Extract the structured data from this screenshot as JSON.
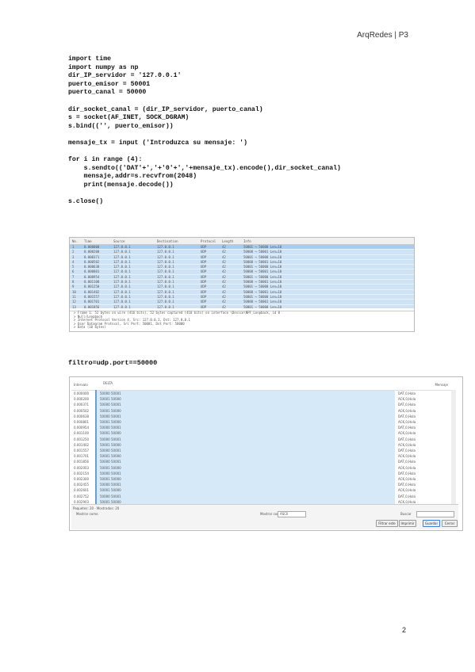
{
  "header": {
    "text": "ArqRedes | P3"
  },
  "code": {
    "lines": [
      "import time",
      "import numpy as np",
      "dir_IP_servidor = '127.0.0.1'",
      "puerto_emisor = 50001",
      "puerto_canal = 50000",
      "",
      "dir_socket_canal = (dir_IP_servidor, puerto_canal)",
      "s = socket(AF_INET, SOCK_DGRAM)",
      "s.bind(('', puerto_emisor))",
      "",
      "mensaje_tx = input ('Introduzca su mensaje: ')",
      "",
      "for i in range (4):",
      "    s.sendto(('DAT'+','+'0'+','+mensaje_tx).encode(),dir_socket_canal)",
      "    mensaje,addr=s.recvfrom(2048)",
      "    print(mensaje.decode())",
      "",
      "s.close()"
    ]
  },
  "capture1": {
    "columns": [
      "No.",
      "Time",
      "Source",
      "Destination",
      "Protocol",
      "Length",
      "Info"
    ],
    "rows": [
      {
        "time": "0.000000",
        "src": "127.0.0.1",
        "dst": "127.0.0.1",
        "proto": "UDP",
        "info": "50001 → 50000 Len=10"
      },
      {
        "time": "0.000200",
        "src": "127.0.0.1",
        "dst": "127.0.0.1",
        "proto": "UDP",
        "info": "50000 → 50001 Len=10"
      },
      {
        "time": "0.000371",
        "src": "127.0.0.1",
        "dst": "127.0.0.1",
        "proto": "UDP",
        "info": "50001 → 50000 Len=10"
      },
      {
        "time": "0.000502",
        "src": "127.0.0.1",
        "dst": "127.0.0.1",
        "proto": "UDP",
        "info": "50000 → 50001 Len=10"
      },
      {
        "time": "0.000638",
        "src": "127.0.0.1",
        "dst": "127.0.0.1",
        "proto": "UDP",
        "info": "50001 → 50000 Len=10"
      },
      {
        "time": "0.000801",
        "src": "127.0.0.1",
        "dst": "127.0.0.1",
        "proto": "UDP",
        "info": "50000 → 50001 Len=10"
      },
      {
        "time": "0.000954",
        "src": "127.0.0.1",
        "dst": "127.0.0.1",
        "proto": "UDP",
        "info": "50001 → 50000 Len=10"
      },
      {
        "time": "0.001100",
        "src": "127.0.0.1",
        "dst": "127.0.0.1",
        "proto": "UDP",
        "info": "50000 → 50001 Len=10"
      },
      {
        "time": "0.001250",
        "src": "127.0.0.1",
        "dst": "127.0.0.1",
        "proto": "UDP",
        "info": "50001 → 50000 Len=10"
      },
      {
        "time": "0.001402",
        "src": "127.0.0.1",
        "dst": "127.0.0.1",
        "proto": "UDP",
        "info": "50000 → 50001 Len=10"
      },
      {
        "time": "0.001557",
        "src": "127.0.0.1",
        "dst": "127.0.0.1",
        "proto": "UDP",
        "info": "50001 → 50000 Len=10"
      },
      {
        "time": "0.001701",
        "src": "127.0.0.1",
        "dst": "127.0.0.1",
        "proto": "UDP",
        "info": "50000 → 50001 Len=10"
      },
      {
        "time": "0.001856",
        "src": "127.0.0.1",
        "dst": "127.0.0.1",
        "proto": "UDP",
        "info": "50001 → 50000 Len=10"
      },
      {
        "time": "0.002003",
        "src": "127.0.0.1",
        "dst": "127.0.0.1",
        "proto": "UDP",
        "info": "50000 → 50001 Len=10"
      },
      {
        "time": "0.002154",
        "src": "127.0.0.1",
        "dst": "127.0.0.1",
        "proto": "UDP",
        "info": "50001 → 50000 Len=10"
      }
    ],
    "detail_tree": [
      "Frame 1: 52 bytes on wire (416 bits), 52 bytes captured (416 bits) on interface \\Device\\NPF_Loopback, id 0",
      "Null/Loopback",
      "Internet Protocol Version 4, Src: 127.0.0.1, Dst: 127.0.0.1",
      "User Datagram Protocol, Src Port: 50001, Dst Port: 50000",
      "Data (10 bytes)"
    ]
  },
  "filter": {
    "text": "filtro=udp.port==50000"
  },
  "capture2": {
    "header_left": "Intervalo",
    "header_mid": "DELTA",
    "header_right": "Mensaje",
    "rows": [
      {
        "t": "0.000000",
        "port": "50000",
        "port2": "50001",
        "msg": "DAT,0,Hola"
      },
      {
        "t": "0.000200",
        "port": "50001",
        "port2": "50000",
        "msg": "ACK,0,Hola"
      },
      {
        "t": "0.000371",
        "port": "50000",
        "port2": "50001",
        "msg": "DAT,0,Hola"
      },
      {
        "t": "0.000502",
        "port": "50001",
        "port2": "50000",
        "msg": "ACK,0,Hola"
      },
      {
        "t": "0.000638",
        "port": "50000",
        "port2": "50001",
        "msg": "DAT,0,Hola"
      },
      {
        "t": "0.000801",
        "port": "50001",
        "port2": "50000",
        "msg": "ACK,0,Hola"
      },
      {
        "t": "0.000954",
        "port": "50000",
        "port2": "50001",
        "msg": "DAT,0,Hola"
      },
      {
        "t": "0.001100",
        "port": "50001",
        "port2": "50000",
        "msg": "ACK,0,Hola"
      },
      {
        "t": "0.001250",
        "port": "50000",
        "port2": "50001",
        "msg": "DAT,0,Hola"
      },
      {
        "t": "0.001402",
        "port": "50001",
        "port2": "50000",
        "msg": "ACK,0,Hola"
      },
      {
        "t": "0.001557",
        "port": "50000",
        "port2": "50001",
        "msg": "DAT,0,Hola"
      },
      {
        "t": "0.001701",
        "port": "50001",
        "port2": "50000",
        "msg": "ACK,0,Hola"
      },
      {
        "t": "0.001856",
        "port": "50000",
        "port2": "50001",
        "msg": "DAT,0,Hola"
      },
      {
        "t": "0.002003",
        "port": "50001",
        "port2": "50000",
        "msg": "ACK,0,Hola"
      },
      {
        "t": "0.002154",
        "port": "50000",
        "port2": "50001",
        "msg": "DAT,0,Hola"
      },
      {
        "t": "0.002300",
        "port": "50001",
        "port2": "50000",
        "msg": "ACK,0,Hola"
      },
      {
        "t": "0.002455",
        "port": "50000",
        "port2": "50001",
        "msg": "DAT,0,Hola"
      },
      {
        "t": "0.002601",
        "port": "50001",
        "port2": "50000",
        "msg": "ACK,0,Hola"
      },
      {
        "t": "0.002752",
        "port": "50000",
        "port2": "50001",
        "msg": "DAT,0,Hola"
      },
      {
        "t": "0.002903",
        "port": "50001",
        "port2": "50000",
        "msg": "ACK,0,Hola"
      }
    ],
    "footer": {
      "status": "Paquetes: 20 · Mostrados: 20",
      "checkbox_label": "Mostrar como",
      "format_label": "Mostrar como",
      "format_value": "ASCII",
      "search_label": "Buscar",
      "btn_filter": "Filtrar este",
      "btn_print": "Imprimir",
      "btn_save": "Guardar",
      "btn_close": "Cerrar",
      "btn_back": "Atrás"
    }
  },
  "page_number": "2"
}
